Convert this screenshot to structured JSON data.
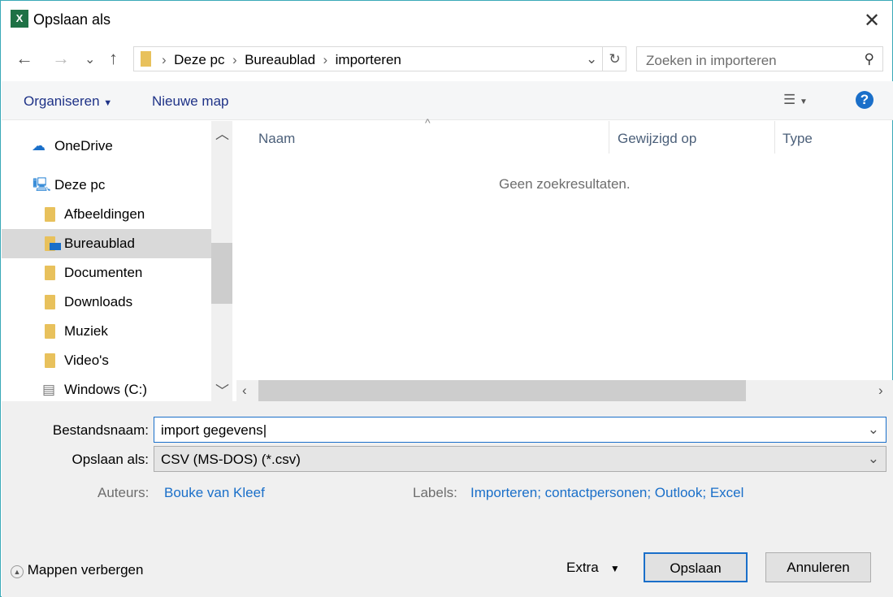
{
  "window": {
    "title": "Opslaan als",
    "app_icon": "excel-icon",
    "close": "✕"
  },
  "nav": {
    "back": "←",
    "forward": "→",
    "recent": "⌄",
    "up": "↑"
  },
  "breadcrumb": [
    "Deze pc",
    "Bureaublad",
    "importeren"
  ],
  "search": {
    "placeholder": "Zoeken in importeren"
  },
  "toolbar": {
    "organize": "Organiseren",
    "new_folder": "Nieuwe map",
    "help": "?"
  },
  "sidebar": {
    "items": [
      {
        "label": "OneDrive",
        "icon": "onedrive-icon"
      },
      {
        "label": "Deze pc",
        "icon": "computer-icon"
      },
      {
        "label": "Afbeeldingen",
        "icon": "pictures-folder-icon"
      },
      {
        "label": "Bureaublad",
        "icon": "desktop-folder-icon",
        "selected": true
      },
      {
        "label": "Documenten",
        "icon": "documents-folder-icon"
      },
      {
        "label": "Downloads",
        "icon": "downloads-folder-icon"
      },
      {
        "label": "Muziek",
        "icon": "music-folder-icon"
      },
      {
        "label": "Video's",
        "icon": "videos-folder-icon"
      },
      {
        "label": "Windows (C:)",
        "icon": "drive-icon"
      }
    ]
  },
  "columns": [
    "Naam",
    "Gewijzigd op",
    "Type"
  ],
  "empty_message": "Geen zoekresultaten.",
  "form": {
    "filename_label": "Bestandsnaam:",
    "filename": "import gegevens",
    "type_label": "Opslaan als:",
    "type": "CSV (MS-DOS) (*.csv)",
    "authors_label": "Auteurs:",
    "authors": "Bouke van Kleef",
    "labels_label": "Labels:",
    "labels": "Importeren; contactpersonen; Outlook; Excel"
  },
  "footer": {
    "hide_folders": "Mappen verbergen",
    "extra": "Extra",
    "save": "Opslaan",
    "cancel": "Annuleren"
  },
  "colors": {
    "accent": "#1a6fc9",
    "selection": "#d9d9d9"
  }
}
